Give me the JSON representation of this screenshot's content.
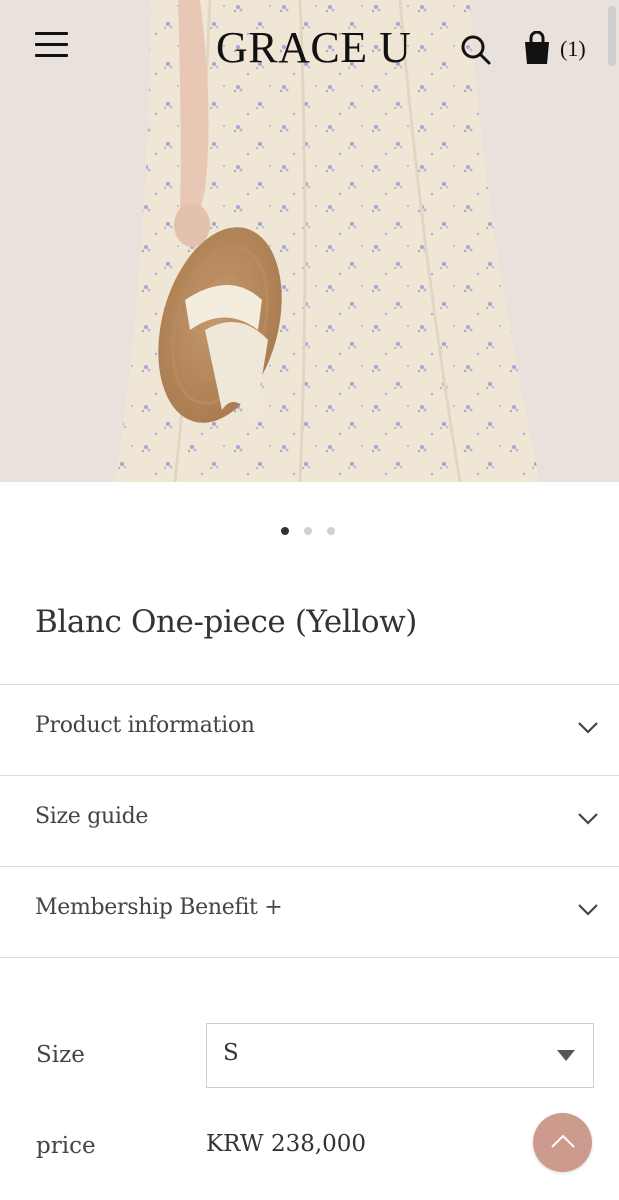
{
  "header": {
    "logo": "GRACE U",
    "cart_count": "(1)",
    "icons": [
      "menu-icon",
      "search-icon",
      "shopping-bag-icon"
    ]
  },
  "gallery": {
    "image_alt": "",
    "slide_count": 3,
    "active_slide": 1
  },
  "product": {
    "title": "Blanc One-piece (Yellow)"
  },
  "accordion": [
    {
      "label": "Product information"
    },
    {
      "label": "Size guide"
    },
    {
      "label": "Membership Benefit +"
    }
  ],
  "options": {
    "size_label": "Size",
    "size_value": "S",
    "price_label": "price",
    "price_value": "KRW 238,000"
  },
  "colors": {
    "accent": "#cd9b8d",
    "background": "#ffffff",
    "text": "#333333"
  }
}
